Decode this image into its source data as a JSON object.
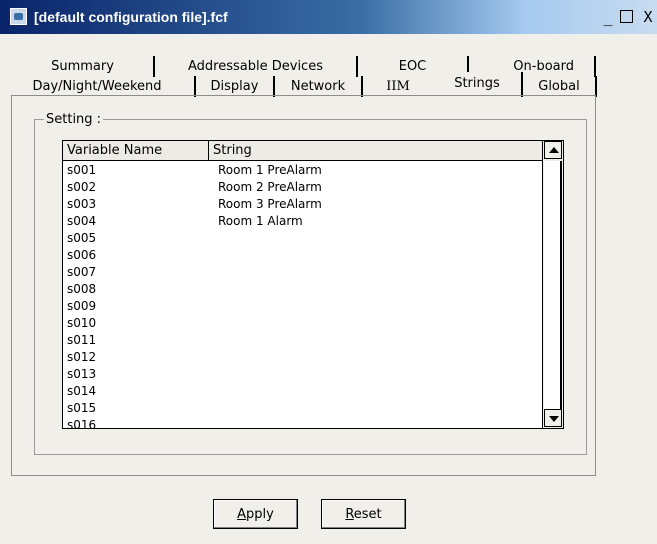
{
  "window": {
    "title": "[default configuration file].fcf"
  },
  "title_buttons": {
    "minimize": "_",
    "maximize": "□",
    "close": "X"
  },
  "tabs_row1": [
    "Summary",
    "Addressable Devices",
    "EOC",
    "On-board"
  ],
  "tabs_row2": [
    "Day/Night/Weekend",
    "Display",
    "Network",
    "IIM",
    "Strings",
    "Global"
  ],
  "active_tab": "Strings",
  "group": {
    "title": "Setting :"
  },
  "table": {
    "columns": [
      "Variable Name",
      "String"
    ],
    "rows": [
      [
        "s001",
        "Room 1 PreAlarm"
      ],
      [
        "s002",
        "Room 2 PreAlarm"
      ],
      [
        "s003",
        "Room 3 PreAlarm"
      ],
      [
        "s004",
        "Room 1 Alarm"
      ],
      [
        "s005",
        ""
      ],
      [
        "s006",
        ""
      ],
      [
        "s007",
        ""
      ],
      [
        "s008",
        ""
      ],
      [
        "s009",
        ""
      ],
      [
        "s010",
        ""
      ],
      [
        "s011",
        ""
      ],
      [
        "s012",
        ""
      ],
      [
        "s013",
        ""
      ],
      [
        "s014",
        ""
      ],
      [
        "s015",
        ""
      ],
      [
        "s016",
        ""
      ]
    ]
  },
  "buttons": {
    "apply": {
      "label": "Apply",
      "mnemonic": "A",
      "rest": "pply"
    },
    "reset": {
      "label": "Reset",
      "mnemonic": "R",
      "rest": "eset"
    }
  }
}
